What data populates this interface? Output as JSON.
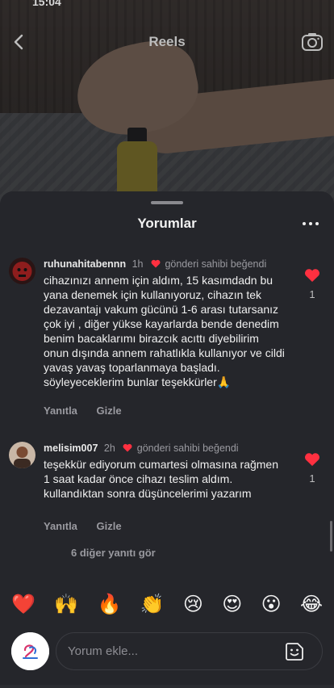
{
  "status_bar": {
    "time": "15:04"
  },
  "reel": {
    "title": "Reels"
  },
  "sheet": {
    "title": "Yorumlar",
    "comments": [
      {
        "username": "ruhunahitabennn",
        "time": "1h",
        "liked_by_author": "gönderi sahibi beğendi",
        "text": "cihazınızı annem için aldım,  15 kasımdadn bu yana denemek için kullanıyoruz, cihazın tek dezavantajı vakum gücünü 1-6 arası tutarsanız çok iyi , diğer yükse kayarlarda bende denedim benim bacaklarımı birazcık acıttı diyebilirim onun dışında annem rahatlıkla kullanıyor ve cildi yavaş yavaş toparlanmaya başladı. söyleyeceklerim bunlar teşekkürler🙏",
        "reply": "Yanıtla",
        "hide": "Gizle",
        "like_count": "1"
      },
      {
        "username": "melisim007",
        "time": "2h",
        "liked_by_author": "gönderi sahibi beğendi",
        "text": "teşekkür ediyorum cumartesi olmasına rağmen 1 saat kadar önce cihazı teslim aldım. kullandıktan sonra düşüncelerimi yazarım",
        "reply": "Yanıtla",
        "hide": "Gizle",
        "like_count": "1"
      }
    ],
    "more_replies": "6 diğer yanıtı gör"
  },
  "emojis": [
    "❤️",
    "🙌",
    "🔥",
    "👏",
    "😢",
    "😍",
    "😮",
    "😂"
  ],
  "composer": {
    "placeholder": "Yorum ekle..."
  },
  "colors": {
    "like_red": "#ff3040",
    "sheet_bg": "#25262b"
  }
}
